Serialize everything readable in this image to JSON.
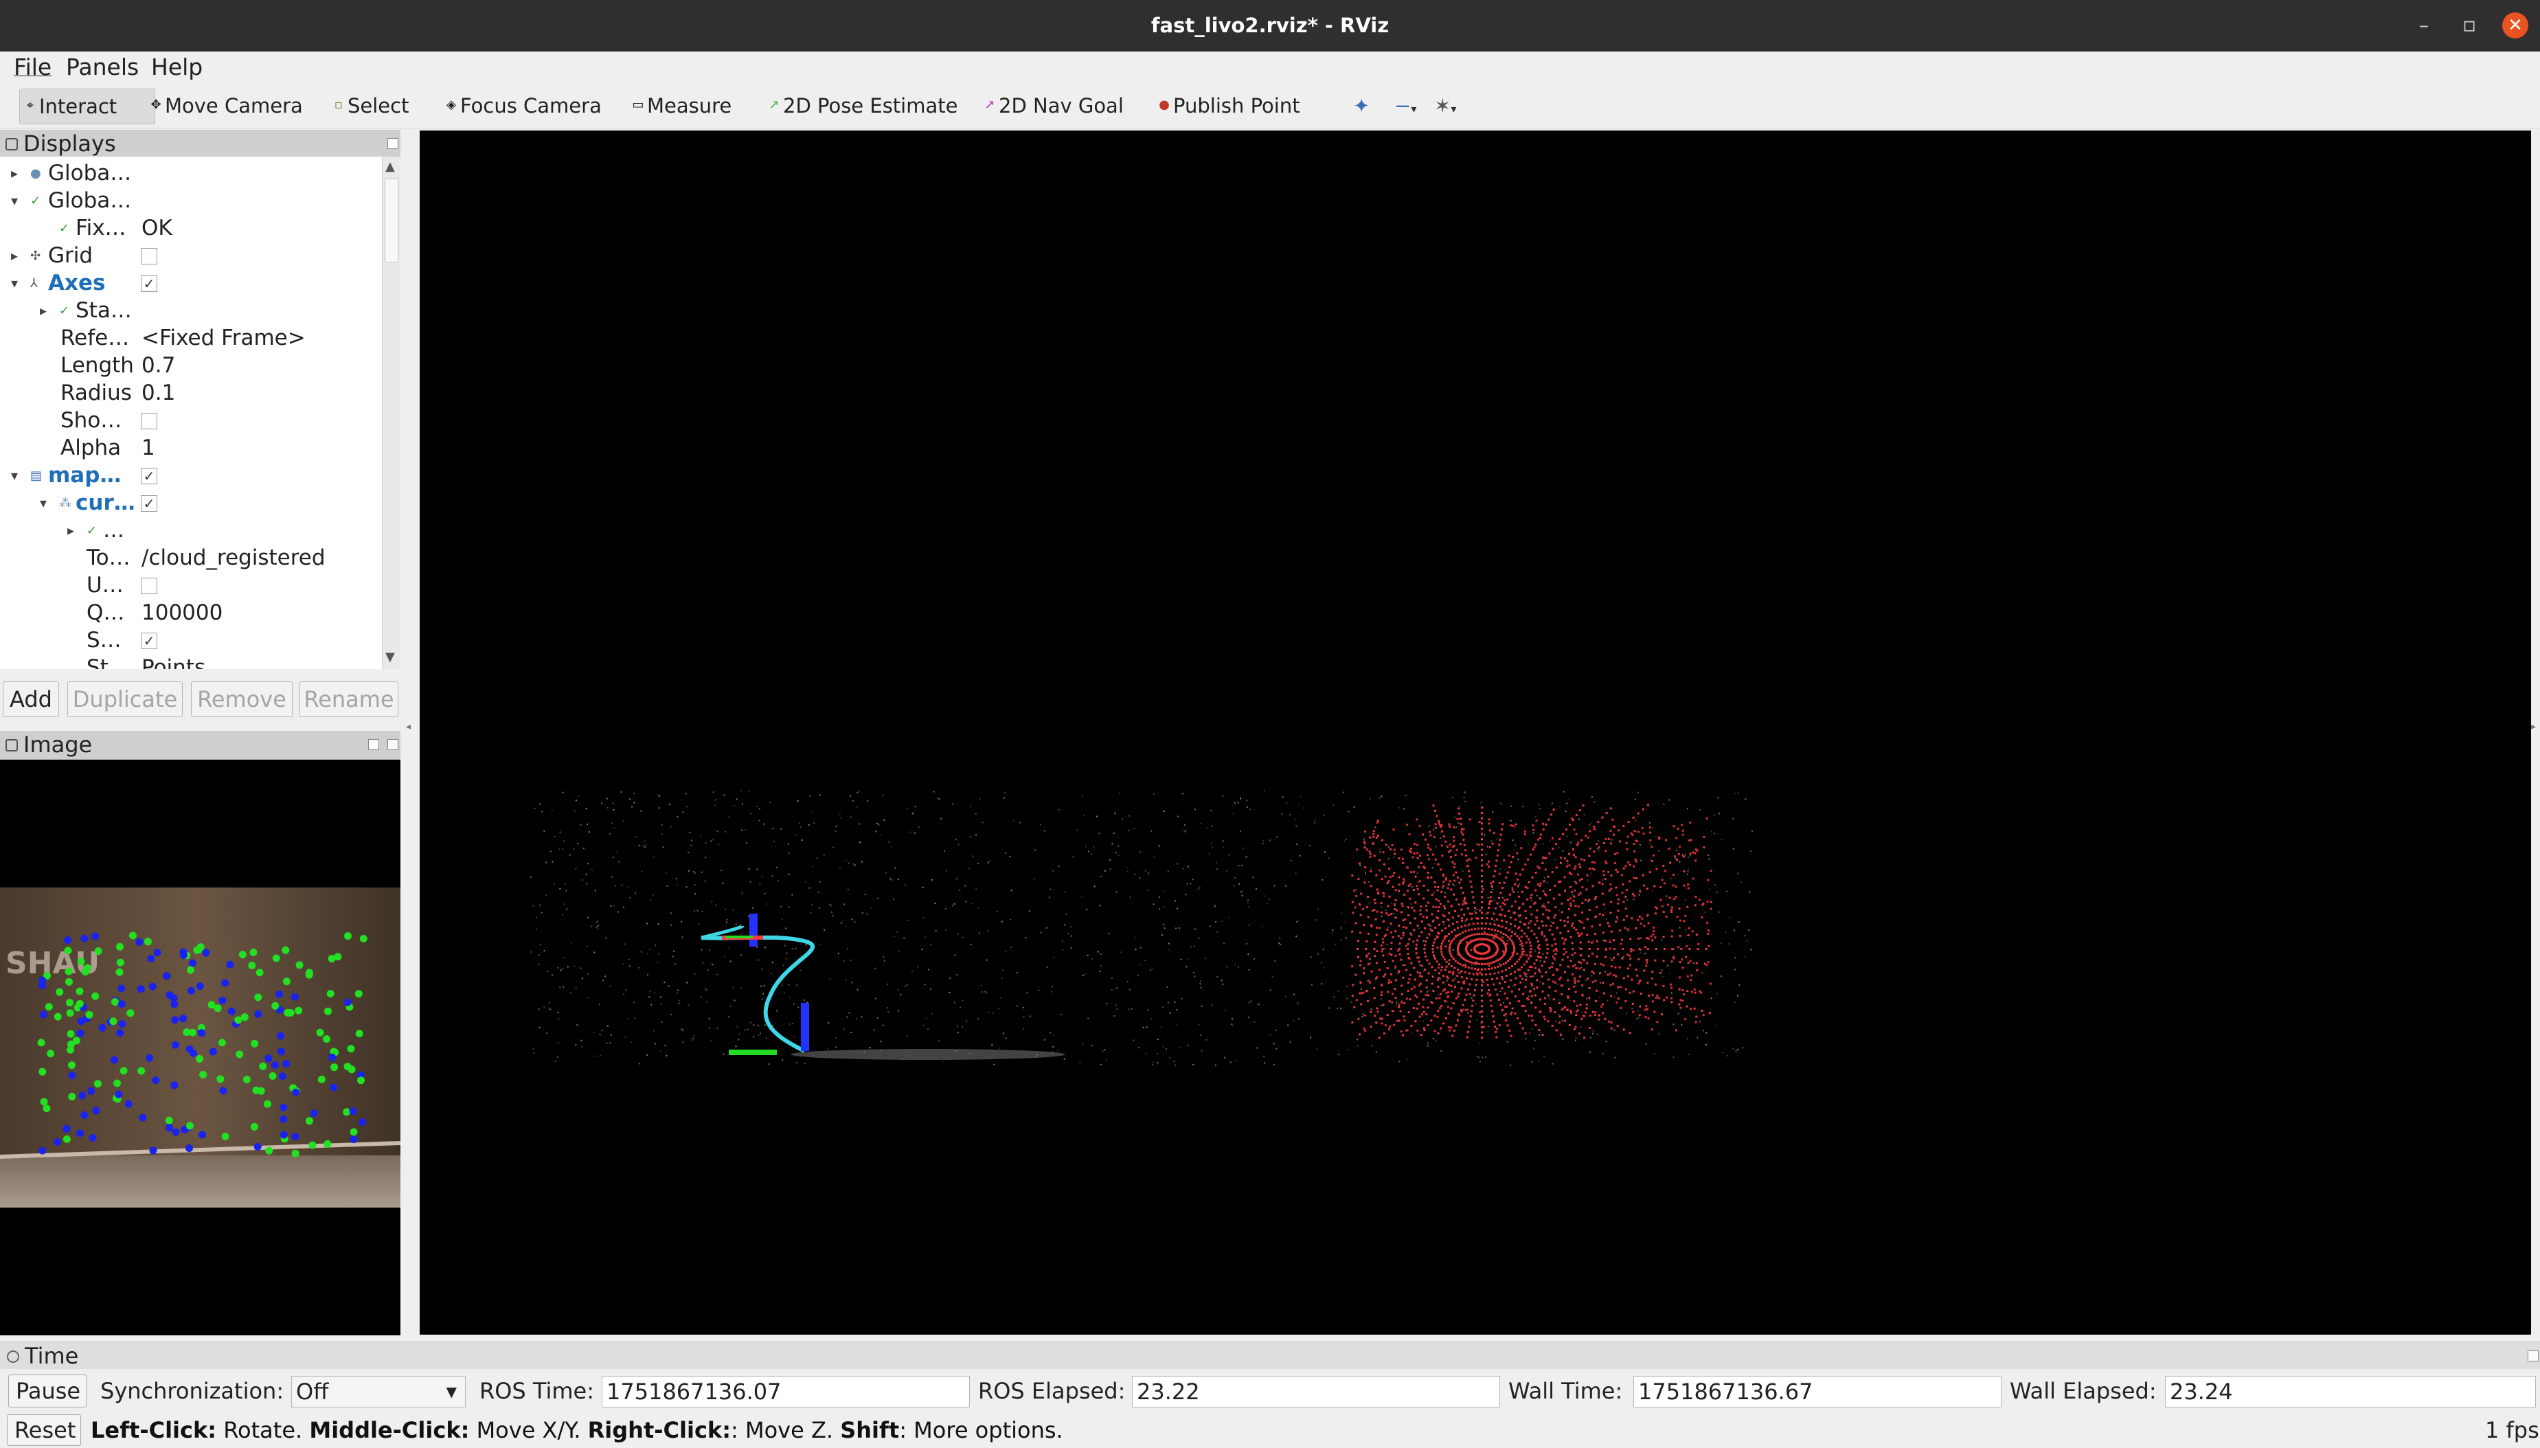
{
  "window": {
    "title": "fast_livo2.rviz* - RViz",
    "minimize": "–",
    "restore": "▫",
    "close": "✕"
  },
  "menu": [
    "File",
    "Panels",
    "Help"
  ],
  "toolbar": {
    "tools": [
      {
        "label": "Interact",
        "icon": "cursor-icon"
      },
      {
        "label": "Move Camera",
        "icon": "move-camera-icon"
      },
      {
        "label": "Select",
        "icon": "select-box-icon"
      },
      {
        "label": "Focus Camera",
        "icon": "focus-camera-icon"
      },
      {
        "label": "Measure",
        "icon": "measure-icon"
      },
      {
        "label": "2D Pose Estimate",
        "icon": "pose-estimate-icon"
      },
      {
        "label": "2D Nav Goal",
        "icon": "nav-goal-icon"
      },
      {
        "label": "Publish Point",
        "icon": "publish-point-icon"
      }
    ],
    "active": "Interact"
  },
  "displays": {
    "title": "Displays",
    "rows": [
      {
        "name": "Globa…",
        "value": ""
      },
      {
        "name": "Globa…",
        "value": ""
      },
      {
        "name": "Fix…",
        "value": "OK"
      },
      {
        "name": "Grid",
        "value": ""
      },
      {
        "name": "Axes",
        "value": ""
      },
      {
        "name": "Sta…",
        "value": ""
      },
      {
        "name": "Refe…",
        "value": "<Fixed Frame>"
      },
      {
        "name": "Length",
        "value": "0.7"
      },
      {
        "name": "Radius",
        "value": "0.1"
      },
      {
        "name": "Sho…",
        "value": ""
      },
      {
        "name": "Alpha",
        "value": "1"
      },
      {
        "name": "map…",
        "value": ""
      },
      {
        "name": "cur…",
        "value": ""
      },
      {
        "name": "…",
        "value": ""
      },
      {
        "name": "To…",
        "value": "/cloud_registered"
      },
      {
        "name": "U…",
        "value": ""
      },
      {
        "name": "Q…",
        "value": "100000"
      },
      {
        "name": "S…",
        "value": ""
      },
      {
        "name": "St…",
        "value": "Points"
      }
    ],
    "buttons": {
      "add": "Add",
      "duplicate": "Duplicate",
      "remove": "Remove",
      "rename": "Rename"
    }
  },
  "image_panel": {
    "title": "Image",
    "sign_text": "SHAU"
  },
  "time": {
    "title": "Time",
    "pause": "Pause",
    "sync_label": "Synchronization:",
    "sync_value": "Off",
    "ros_time_label": "ROS Time:",
    "ros_time": "1751867136.07",
    "ros_elapsed_label": "ROS Elapsed:",
    "ros_elapsed": "23.22",
    "wall_time_label": "Wall Time:",
    "wall_time": "1751867136.67",
    "wall_elapsed_label": "Wall Elapsed:",
    "wall_elapsed": "23.24"
  },
  "status": {
    "reset": "Reset",
    "k1": "Left-Click:",
    "v1": " Rotate. ",
    "k2": "Middle-Click:",
    "v2": " Move X/Y. ",
    "k3": "Right-Click:",
    "v3": ": Move Z. ",
    "k4": "Shift",
    "v4": ": More options.",
    "fps": "1 fps"
  },
  "colors": {
    "titlebar": "#2f2f2f",
    "close": "#e95420",
    "highlight": "#1f6fb8",
    "cloud": "#e8383c",
    "trajectory": "#3fd6e6"
  }
}
